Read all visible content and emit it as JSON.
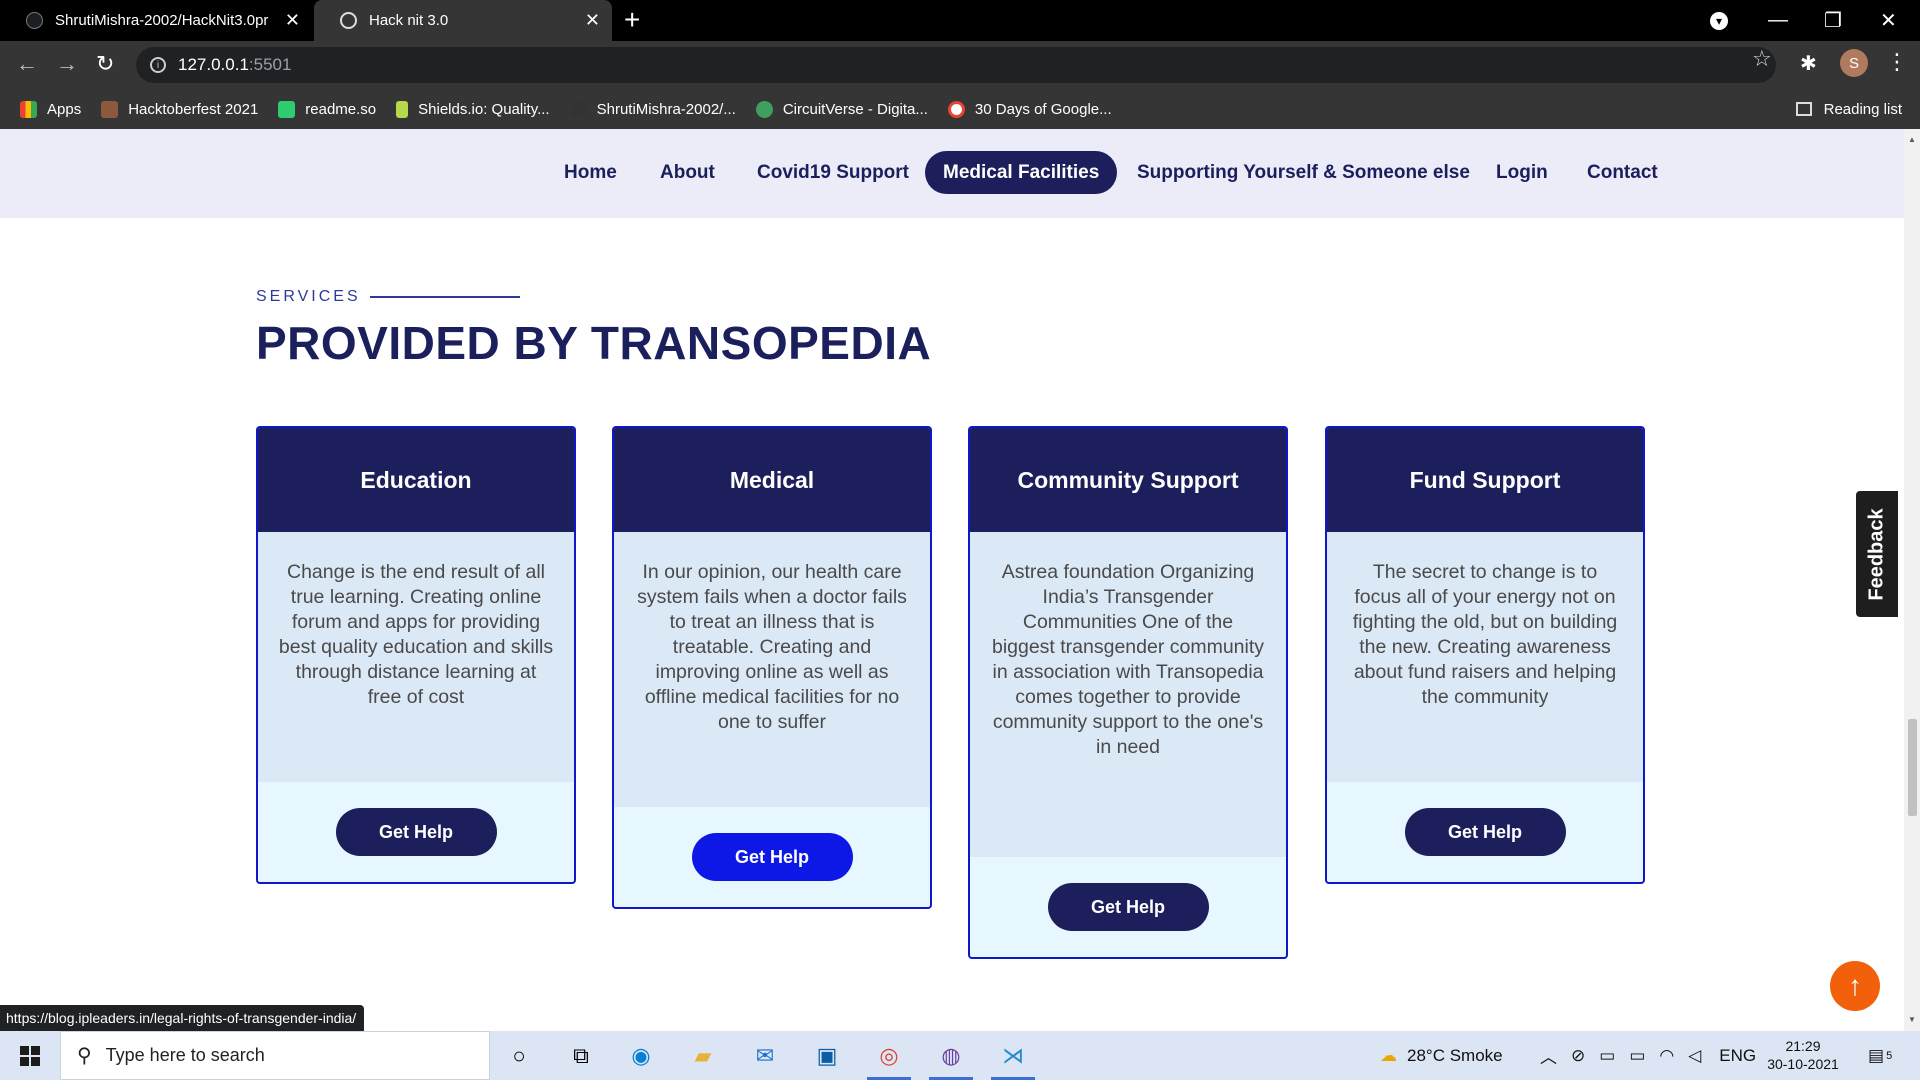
{
  "browser": {
    "tabs": [
      {
        "title": "ShrutiMishra-2002/HackNit3.0pr",
        "active": false
      },
      {
        "title": "Hack nit 3.0",
        "active": true
      }
    ],
    "url_host": "127.0.0.1",
    "url_port": ":5501",
    "bookmarks": [
      {
        "label": "Apps",
        "color": "#e94235"
      },
      {
        "label": "Hacktoberfest 2021",
        "color": "#8a5a3c"
      },
      {
        "label": "readme.so",
        "color": "#2ecc71"
      },
      {
        "label": "Shields.io: Quality...",
        "color": "#b6d94c"
      },
      {
        "label": "ShrutiMishra-2002/...",
        "color": "#333333"
      },
      {
        "label": "CircuitVerse - Digita...",
        "color": "#3f9f5f"
      },
      {
        "label": "30 Days of Google...",
        "color": "#ffffff"
      }
    ],
    "reading_list": "Reading list",
    "profile_initial": "S",
    "status_url": "https://blog.ipleaders.in/legal-rights-of-transgender-india/"
  },
  "nav": {
    "items": [
      "Home",
      "About",
      "Covid19 Support",
      "Medical Facilities",
      "Supporting Yourself & Someone else",
      "Login",
      "Contact"
    ],
    "active": "Medical Facilities"
  },
  "section": {
    "kicker": "SERVICES",
    "title": "PROVIDED BY TRANSOPEDIA"
  },
  "cards": [
    {
      "title": "Education",
      "text": "Change is the end result of all true learning. Creating online forum and apps for providing best quality education and skills through distance learning at free of cost",
      "button": "Get Help"
    },
    {
      "title": "Medical",
      "text": "In our opinion, our health care system fails when a doctor fails to treat an illness that is treatable. Creating and improving online as well as offline medical facilities for no one to suffer",
      "button": "Get Help"
    },
    {
      "title": "Community Support",
      "text": "Astrea foundation Organizing India’s Transgender Communities One of the biggest transgender community in association with Transopedia comes together to provide community support to the one's in need",
      "button": "Get Help"
    },
    {
      "title": "Fund Support",
      "text": "The secret to change is to focus all of your energy not on fighting the old, but on building the new. Creating awareness about fund raisers and helping the community",
      "button": "Get Help"
    }
  ],
  "feedback_label": "Feedback",
  "taskbar": {
    "search_placeholder": "Type here to search",
    "weather": "28°C  Smoke",
    "language": "ENG",
    "time": "21:29",
    "date": "30-10-2021",
    "notification_count": "5"
  },
  "colors": {
    "navy": "#1c1f5b",
    "accent_blue": "#0d17e6",
    "card_border": "#0f18c9",
    "scroll_top": "#f2600c"
  }
}
